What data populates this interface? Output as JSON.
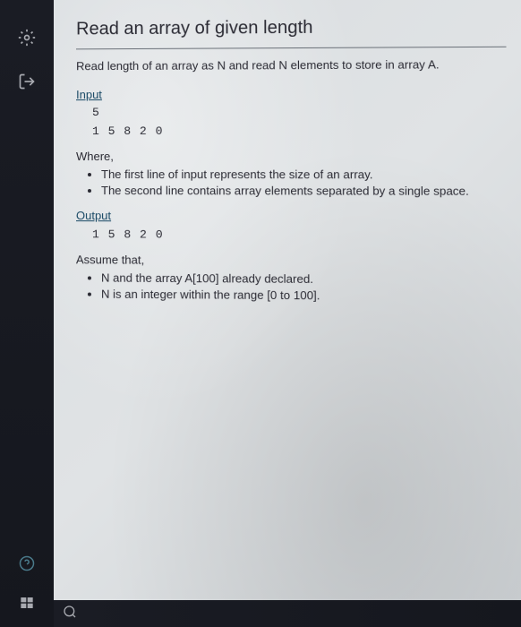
{
  "page": {
    "title": "Read an array of given length",
    "subtitle": "Read length of an array as N and read N elements to store in array A."
  },
  "input": {
    "header": "Input",
    "line1": "5",
    "line2": "1 5 8 2 0"
  },
  "where": {
    "label": "Where,",
    "bullets": [
      "The first line of input represents the size of an array.",
      "The second line contains array elements separated by a single space."
    ]
  },
  "output": {
    "header": "Output",
    "line1": "1 5 8 2 0"
  },
  "assume": {
    "label": "Assume that,",
    "bullets": [
      "N and the array A[100] already declared.",
      "N is an integer within the range [0 to 100]."
    ]
  }
}
